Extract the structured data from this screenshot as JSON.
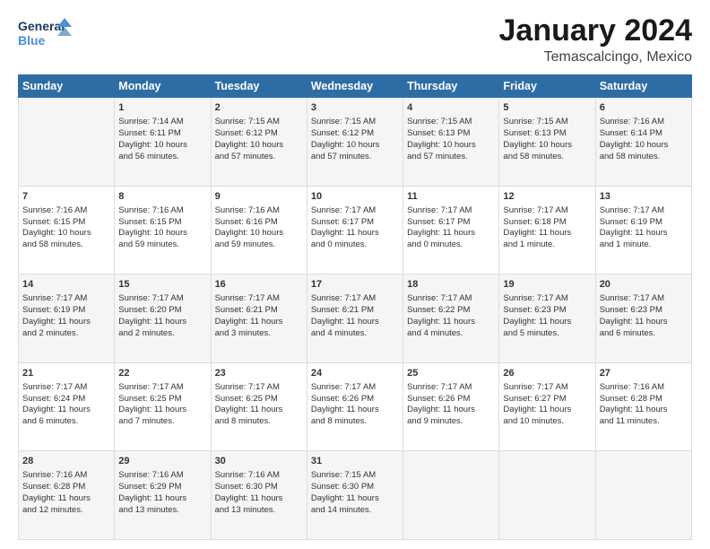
{
  "logo": {
    "line1": "General",
    "line2": "Blue"
  },
  "title": "January 2024",
  "subtitle": "Temascalcingo, Mexico",
  "days_header": [
    "Sunday",
    "Monday",
    "Tuesday",
    "Wednesday",
    "Thursday",
    "Friday",
    "Saturday"
  ],
  "weeks": [
    [
      {
        "day": "",
        "content": ""
      },
      {
        "day": "1",
        "content": "Sunrise: 7:14 AM\nSunset: 6:11 PM\nDaylight: 10 hours\nand 56 minutes."
      },
      {
        "day": "2",
        "content": "Sunrise: 7:15 AM\nSunset: 6:12 PM\nDaylight: 10 hours\nand 57 minutes."
      },
      {
        "day": "3",
        "content": "Sunrise: 7:15 AM\nSunset: 6:12 PM\nDaylight: 10 hours\nand 57 minutes."
      },
      {
        "day": "4",
        "content": "Sunrise: 7:15 AM\nSunset: 6:13 PM\nDaylight: 10 hours\nand 57 minutes."
      },
      {
        "day": "5",
        "content": "Sunrise: 7:15 AM\nSunset: 6:13 PM\nDaylight: 10 hours\nand 58 minutes."
      },
      {
        "day": "6",
        "content": "Sunrise: 7:16 AM\nSunset: 6:14 PM\nDaylight: 10 hours\nand 58 minutes."
      }
    ],
    [
      {
        "day": "7",
        "content": "Sunrise: 7:16 AM\nSunset: 6:15 PM\nDaylight: 10 hours\nand 58 minutes."
      },
      {
        "day": "8",
        "content": "Sunrise: 7:16 AM\nSunset: 6:15 PM\nDaylight: 10 hours\nand 59 minutes."
      },
      {
        "day": "9",
        "content": "Sunrise: 7:16 AM\nSunset: 6:16 PM\nDaylight: 10 hours\nand 59 minutes."
      },
      {
        "day": "10",
        "content": "Sunrise: 7:17 AM\nSunset: 6:17 PM\nDaylight: 11 hours\nand 0 minutes."
      },
      {
        "day": "11",
        "content": "Sunrise: 7:17 AM\nSunset: 6:17 PM\nDaylight: 11 hours\nand 0 minutes."
      },
      {
        "day": "12",
        "content": "Sunrise: 7:17 AM\nSunset: 6:18 PM\nDaylight: 11 hours\nand 1 minute."
      },
      {
        "day": "13",
        "content": "Sunrise: 7:17 AM\nSunset: 6:19 PM\nDaylight: 11 hours\nand 1 minute."
      }
    ],
    [
      {
        "day": "14",
        "content": "Sunrise: 7:17 AM\nSunset: 6:19 PM\nDaylight: 11 hours\nand 2 minutes."
      },
      {
        "day": "15",
        "content": "Sunrise: 7:17 AM\nSunset: 6:20 PM\nDaylight: 11 hours\nand 2 minutes."
      },
      {
        "day": "16",
        "content": "Sunrise: 7:17 AM\nSunset: 6:21 PM\nDaylight: 11 hours\nand 3 minutes."
      },
      {
        "day": "17",
        "content": "Sunrise: 7:17 AM\nSunset: 6:21 PM\nDaylight: 11 hours\nand 4 minutes."
      },
      {
        "day": "18",
        "content": "Sunrise: 7:17 AM\nSunset: 6:22 PM\nDaylight: 11 hours\nand 4 minutes."
      },
      {
        "day": "19",
        "content": "Sunrise: 7:17 AM\nSunset: 6:23 PM\nDaylight: 11 hours\nand 5 minutes."
      },
      {
        "day": "20",
        "content": "Sunrise: 7:17 AM\nSunset: 6:23 PM\nDaylight: 11 hours\nand 6 minutes."
      }
    ],
    [
      {
        "day": "21",
        "content": "Sunrise: 7:17 AM\nSunset: 6:24 PM\nDaylight: 11 hours\nand 6 minutes."
      },
      {
        "day": "22",
        "content": "Sunrise: 7:17 AM\nSunset: 6:25 PM\nDaylight: 11 hours\nand 7 minutes."
      },
      {
        "day": "23",
        "content": "Sunrise: 7:17 AM\nSunset: 6:25 PM\nDaylight: 11 hours\nand 8 minutes."
      },
      {
        "day": "24",
        "content": "Sunrise: 7:17 AM\nSunset: 6:26 PM\nDaylight: 11 hours\nand 8 minutes."
      },
      {
        "day": "25",
        "content": "Sunrise: 7:17 AM\nSunset: 6:26 PM\nDaylight: 11 hours\nand 9 minutes."
      },
      {
        "day": "26",
        "content": "Sunrise: 7:17 AM\nSunset: 6:27 PM\nDaylight: 11 hours\nand 10 minutes."
      },
      {
        "day": "27",
        "content": "Sunrise: 7:16 AM\nSunset: 6:28 PM\nDaylight: 11 hours\nand 11 minutes."
      }
    ],
    [
      {
        "day": "28",
        "content": "Sunrise: 7:16 AM\nSunset: 6:28 PM\nDaylight: 11 hours\nand 12 minutes."
      },
      {
        "day": "29",
        "content": "Sunrise: 7:16 AM\nSunset: 6:29 PM\nDaylight: 11 hours\nand 13 minutes."
      },
      {
        "day": "30",
        "content": "Sunrise: 7:16 AM\nSunset: 6:30 PM\nDaylight: 11 hours\nand 13 minutes."
      },
      {
        "day": "31",
        "content": "Sunrise: 7:15 AM\nSunset: 6:30 PM\nDaylight: 11 hours\nand 14 minutes."
      },
      {
        "day": "",
        "content": ""
      },
      {
        "day": "",
        "content": ""
      },
      {
        "day": "",
        "content": ""
      }
    ]
  ]
}
